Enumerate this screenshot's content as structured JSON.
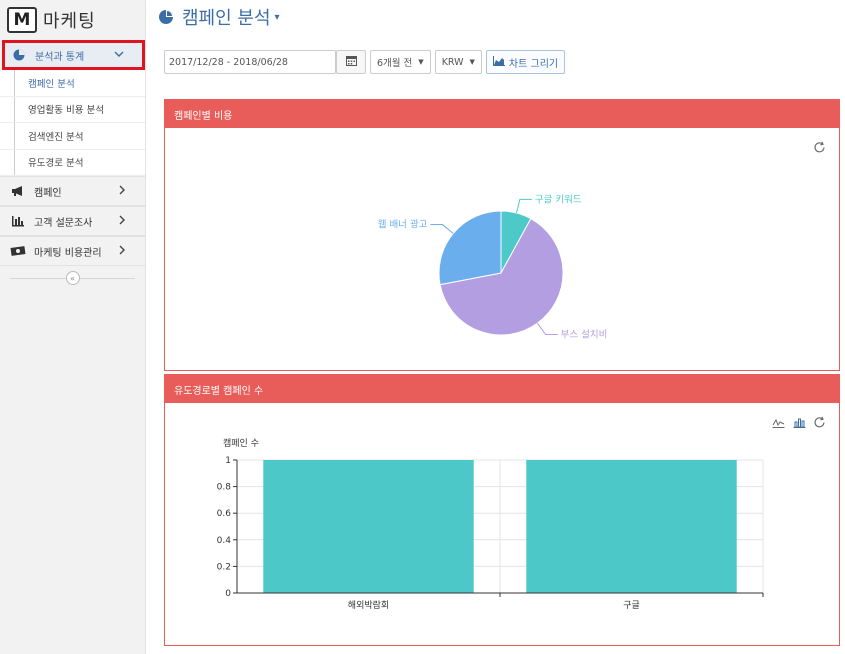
{
  "app": {
    "logo_letter": "M",
    "brand": "마케팅"
  },
  "sidebar": {
    "active_menu": {
      "label": "분석과 통계",
      "icon": "pie-chart-icon"
    },
    "submenu": [
      {
        "label": "캠페인 분석",
        "active": true
      },
      {
        "label": "영업활동 비용 분석",
        "active": false
      },
      {
        "label": "검색엔진 분석",
        "active": false
      },
      {
        "label": "유도경로 분석",
        "active": false
      }
    ],
    "menus": [
      {
        "label": "캠페인",
        "icon": "megaphone-icon"
      },
      {
        "label": "고객 설문조사",
        "icon": "bar-chart-icon"
      },
      {
        "label": "마케팅 비용관리",
        "icon": "money-icon"
      }
    ],
    "collapse_glyph": "«"
  },
  "page": {
    "title": "캠페인 분석"
  },
  "toolbar": {
    "date_range": "2017/12/28 - 2018/06/28",
    "period_select": "6개월 전",
    "currency_select": "KRW",
    "chart_button": "차트 그리기"
  },
  "panels": {
    "pie": {
      "title": "캠페인별 비용"
    },
    "bar": {
      "title": "유도경로별 캠페인 수"
    }
  },
  "chart_data": [
    {
      "type": "pie",
      "title": "캠페인별 비용",
      "slices": [
        {
          "label": "구글 키워드",
          "value": 8,
          "color": "#4dc9c9"
        },
        {
          "label": "부스 설치비",
          "value": 64,
          "color": "#b29ee0"
        },
        {
          "label": "웹 배너 광고",
          "value": 28,
          "color": "#6aaeee"
        }
      ]
    },
    {
      "type": "bar",
      "title": "유도경로별 캠페인 수",
      "ylabel": "캠페인 수",
      "categories": [
        "해외박람회",
        "구글"
      ],
      "values": [
        1,
        1
      ],
      "ylim": [
        0,
        1
      ],
      "yticks": [
        "0",
        "0.2",
        "0.4",
        "0.6",
        "0.8",
        "1"
      ],
      "color": "#4dc8c9"
    }
  ]
}
